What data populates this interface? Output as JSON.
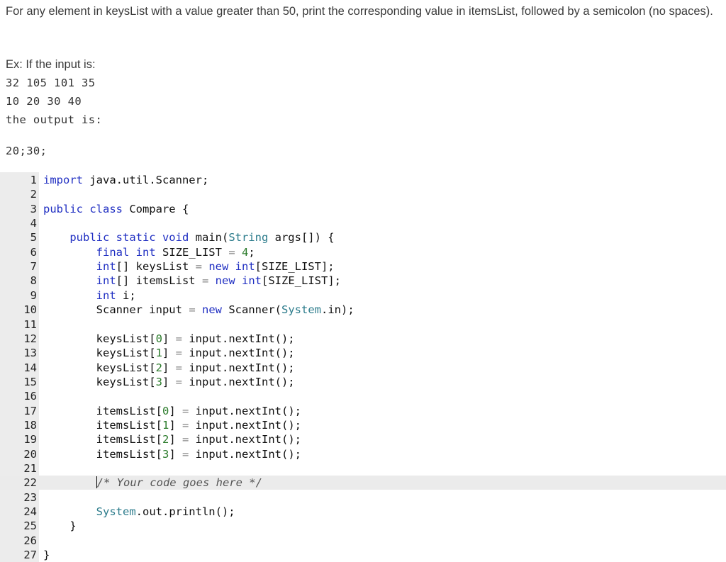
{
  "problem": {
    "text": "For any element in keysList with a value greater than 50, print the corresponding value in itemsList, followed by a semicolon (no spaces).",
    "example_label": "Ex: If the input is:",
    "input_lines": [
      "32 105 101 35",
      "10 20 30 40"
    ],
    "output_label": "the output is:",
    "output_value": "20;30;"
  },
  "editor": {
    "active_line": 22,
    "lines": [
      {
        "n": "1",
        "tokens": [
          {
            "t": "import",
            "c": "kw"
          },
          {
            "t": " java.util.Scanner;",
            "c": ""
          }
        ]
      },
      {
        "n": "2",
        "tokens": []
      },
      {
        "n": "3",
        "tokens": [
          {
            "t": "public class",
            "c": "kw"
          },
          {
            "t": " Compare {",
            "c": ""
          }
        ]
      },
      {
        "n": "4",
        "tokens": []
      },
      {
        "n": "5",
        "tokens": [
          {
            "t": "    ",
            "c": ""
          },
          {
            "t": "public static void",
            "c": "kw"
          },
          {
            "t": " main(",
            "c": ""
          },
          {
            "t": "String",
            "c": "cls"
          },
          {
            "t": " args[]) {",
            "c": ""
          }
        ]
      },
      {
        "n": "6",
        "tokens": [
          {
            "t": "        ",
            "c": ""
          },
          {
            "t": "final int",
            "c": "kw"
          },
          {
            "t": " SIZE_LIST ",
            "c": ""
          },
          {
            "t": "=",
            "c": "op"
          },
          {
            "t": " ",
            "c": ""
          },
          {
            "t": "4",
            "c": "num"
          },
          {
            "t": ";",
            "c": ""
          }
        ]
      },
      {
        "n": "7",
        "tokens": [
          {
            "t": "        ",
            "c": ""
          },
          {
            "t": "int",
            "c": "kw"
          },
          {
            "t": "[] keysList ",
            "c": ""
          },
          {
            "t": "=",
            "c": "op"
          },
          {
            "t": " ",
            "c": ""
          },
          {
            "t": "new int",
            "c": "kw"
          },
          {
            "t": "[SIZE_LIST];",
            "c": ""
          }
        ]
      },
      {
        "n": "8",
        "tokens": [
          {
            "t": "        ",
            "c": ""
          },
          {
            "t": "int",
            "c": "kw"
          },
          {
            "t": "[] itemsList ",
            "c": ""
          },
          {
            "t": "=",
            "c": "op"
          },
          {
            "t": " ",
            "c": ""
          },
          {
            "t": "new int",
            "c": "kw"
          },
          {
            "t": "[SIZE_LIST];",
            "c": ""
          }
        ]
      },
      {
        "n": "9",
        "tokens": [
          {
            "t": "        ",
            "c": ""
          },
          {
            "t": "int",
            "c": "kw"
          },
          {
            "t": " i;",
            "c": ""
          }
        ]
      },
      {
        "n": "10",
        "tokens": [
          {
            "t": "        Scanner input ",
            "c": ""
          },
          {
            "t": "=",
            "c": "op"
          },
          {
            "t": " ",
            "c": ""
          },
          {
            "t": "new",
            "c": "kw"
          },
          {
            "t": " Scanner(",
            "c": ""
          },
          {
            "t": "System",
            "c": "cls"
          },
          {
            "t": ".in);",
            "c": ""
          }
        ]
      },
      {
        "n": "11",
        "tokens": []
      },
      {
        "n": "12",
        "tokens": [
          {
            "t": "        keysList[",
            "c": ""
          },
          {
            "t": "0",
            "c": "num"
          },
          {
            "t": "] ",
            "c": ""
          },
          {
            "t": "=",
            "c": "op"
          },
          {
            "t": " input.nextInt();",
            "c": ""
          }
        ]
      },
      {
        "n": "13",
        "tokens": [
          {
            "t": "        keysList[",
            "c": ""
          },
          {
            "t": "1",
            "c": "num"
          },
          {
            "t": "] ",
            "c": ""
          },
          {
            "t": "=",
            "c": "op"
          },
          {
            "t": " input.nextInt();",
            "c": ""
          }
        ]
      },
      {
        "n": "14",
        "tokens": [
          {
            "t": "        keysList[",
            "c": ""
          },
          {
            "t": "2",
            "c": "num"
          },
          {
            "t": "] ",
            "c": ""
          },
          {
            "t": "=",
            "c": "op"
          },
          {
            "t": " input.nextInt();",
            "c": ""
          }
        ]
      },
      {
        "n": "15",
        "tokens": [
          {
            "t": "        keysList[",
            "c": ""
          },
          {
            "t": "3",
            "c": "num"
          },
          {
            "t": "] ",
            "c": ""
          },
          {
            "t": "=",
            "c": "op"
          },
          {
            "t": " input.nextInt();",
            "c": ""
          }
        ]
      },
      {
        "n": "16",
        "tokens": []
      },
      {
        "n": "17",
        "tokens": [
          {
            "t": "        itemsList[",
            "c": ""
          },
          {
            "t": "0",
            "c": "num"
          },
          {
            "t": "] ",
            "c": ""
          },
          {
            "t": "=",
            "c": "op"
          },
          {
            "t": " input.nextInt();",
            "c": ""
          }
        ]
      },
      {
        "n": "18",
        "tokens": [
          {
            "t": "        itemsList[",
            "c": ""
          },
          {
            "t": "1",
            "c": "num"
          },
          {
            "t": "] ",
            "c": ""
          },
          {
            "t": "=",
            "c": "op"
          },
          {
            "t": " input.nextInt();",
            "c": ""
          }
        ]
      },
      {
        "n": "19",
        "tokens": [
          {
            "t": "        itemsList[",
            "c": ""
          },
          {
            "t": "2",
            "c": "num"
          },
          {
            "t": "] ",
            "c": ""
          },
          {
            "t": "=",
            "c": "op"
          },
          {
            "t": " input.nextInt();",
            "c": ""
          }
        ]
      },
      {
        "n": "20",
        "tokens": [
          {
            "t": "        itemsList[",
            "c": ""
          },
          {
            "t": "3",
            "c": "num"
          },
          {
            "t": "] ",
            "c": ""
          },
          {
            "t": "=",
            "c": "op"
          },
          {
            "t": " input.nextInt();",
            "c": ""
          }
        ]
      },
      {
        "n": "21",
        "tokens": []
      },
      {
        "n": "22",
        "tokens": [
          {
            "t": "        ",
            "c": ""
          },
          {
            "t": "CURSOR",
            "c": "cursor"
          },
          {
            "t": "/* Your code goes here */",
            "c": "cmt"
          }
        ]
      },
      {
        "n": "23",
        "tokens": []
      },
      {
        "n": "24",
        "tokens": [
          {
            "t": "        ",
            "c": ""
          },
          {
            "t": "System",
            "c": "cls"
          },
          {
            "t": ".out.println();",
            "c": ""
          }
        ]
      },
      {
        "n": "25",
        "tokens": [
          {
            "t": "    }",
            "c": ""
          }
        ]
      },
      {
        "n": "26",
        "tokens": []
      },
      {
        "n": "27",
        "tokens": [
          {
            "t": "}",
            "c": ""
          }
        ]
      }
    ]
  }
}
